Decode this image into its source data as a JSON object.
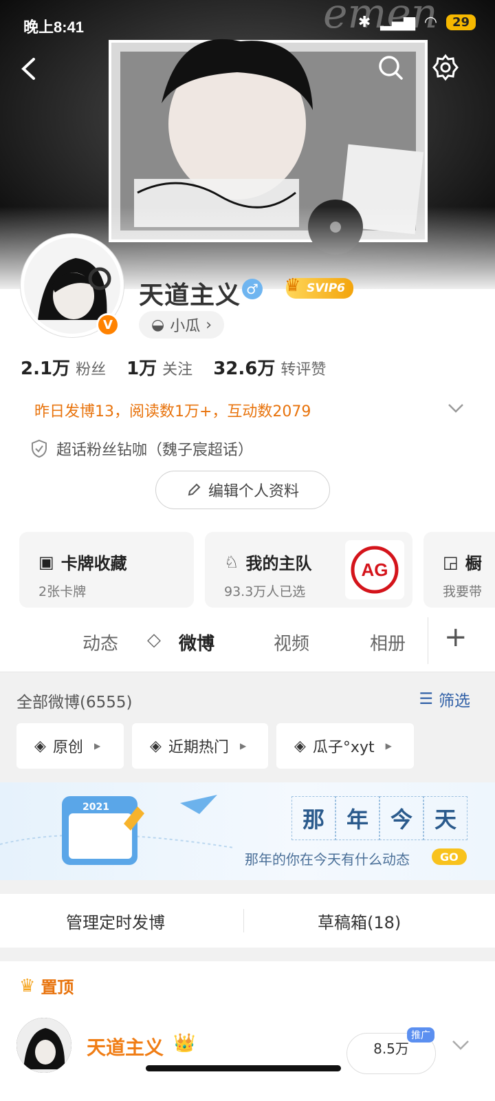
{
  "status_bar": {
    "time": "晚上8:41",
    "battery": "29"
  },
  "profile": {
    "name": "天道主义",
    "svip": "SVIP6",
    "tag": "小瓜",
    "stats": [
      {
        "value": "2.1万",
        "label": "粉丝"
      },
      {
        "value": "1万",
        "label": "关注"
      },
      {
        "value": "32.6万",
        "label": "转评赞"
      }
    ],
    "daily_info": "昨日发博13，阅读数1万+，互动数2079",
    "super_topic": "超话粉丝钻咖（魏子宸超话）",
    "edit_label": "编辑个人资料"
  },
  "cards": [
    {
      "title": "卡牌收藏",
      "sub": "2张卡牌"
    },
    {
      "title": "我的主队",
      "sub": "93.3万人已选"
    },
    {
      "title": "橱",
      "sub": "我要带"
    }
  ],
  "tabs": [
    "动态",
    "微博",
    "视频",
    "相册"
  ],
  "filter": {
    "title": "全部微博(6555)",
    "filter_label": "筛选",
    "chips": [
      "原创",
      "近期热门",
      "瓜子°xyt"
    ]
  },
  "memory": {
    "chars": [
      "那",
      "年",
      "今",
      "天"
    ],
    "sub": "那年的你在今天有什么动态",
    "go": "GO"
  },
  "schedule": {
    "left": "管理定时发博",
    "right": "草稿箱(18)"
  },
  "pinned": {
    "title": "置顶",
    "author": "天道主义",
    "views": "8.5万",
    "promo": "推广"
  },
  "colors": {
    "accent_orange": "#e8730c",
    "blue": "#2f5fa6",
    "svip_gold": "#f3a40c"
  }
}
